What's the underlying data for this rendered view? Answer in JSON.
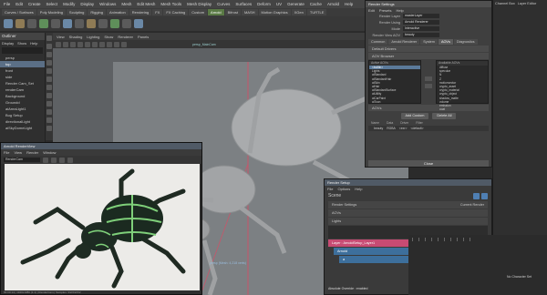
{
  "menubar": {
    "items": [
      "File",
      "Edit",
      "Create",
      "Select",
      "Modify",
      "Display",
      "Windows",
      "Mesh",
      "Edit Mesh",
      "Mesh Tools",
      "Mesh Display",
      "Curves",
      "Surfaces",
      "Deform",
      "UV",
      "Generate",
      "Cache",
      "Arnold",
      "Help"
    ]
  },
  "shelf": {
    "tabs": [
      "Curves / Surfaces",
      "Poly Modeling",
      "Sculpting",
      "Rigging",
      "Animation",
      "Rendering",
      "FX",
      "FX Caching",
      "Custom",
      "Arnold",
      "Bifrost",
      "MASH",
      "Motion Graphics",
      "XGen",
      "TURTLE"
    ],
    "active_index": 9
  },
  "outliner": {
    "title": "Outliner",
    "menu": [
      "Display",
      "Show",
      "Help"
    ],
    "items": [
      "persp",
      "top",
      "front",
      "side",
      "Render Cam_Set",
      "renderCam",
      "Background",
      "Groundd",
      "aiAreaLight1",
      "Bug Setup",
      "directionalLight",
      "aiSkyDomeLight"
    ],
    "selected_index": 1
  },
  "viewport": {
    "menu": [
      "View",
      "Shading",
      "Lighting",
      "Show",
      "Renderer",
      "Panels"
    ],
    "camera_label": "persp_MainCam",
    "status": "persp (Mesh: 4,218 verts)"
  },
  "render_view": {
    "title": "Arnold RenderView",
    "menu": [
      "File",
      "View",
      "Render",
      "Window"
    ],
    "camera": "RenderCam",
    "status": "00:00:14 | 1920x1080 (1:1) | RenderCam | Samples: 3/2/2/2/2/2"
  },
  "render_settings": {
    "title": "Render Settings",
    "menu": [
      "Edit",
      "Presets",
      "Help"
    ],
    "render_layer_label": "Render Layer",
    "render_layer_value": "masterLayer",
    "render_using_label": "Render Using",
    "render_using_value": "Arnold Renderer",
    "mode_label": "Mode",
    "mode_value": "Interactive",
    "render_view_aovs_label": "Render View AOV",
    "render_view_aovs_value": "beauty",
    "tabs": [
      "Common",
      "Arnold Renderer",
      "System",
      "AOVs",
      "Diagnostics"
    ],
    "active_tab_index": 3,
    "sections": [
      "Default Drivers",
      "AOV Browser"
    ],
    "aov_active_header": "Active AOVs",
    "aov_available_header": "Available AOVs",
    "aov_source_list": [
      "<builtin>",
      "Lights",
      "aiStandard",
      "aiStandardHair",
      "aiSkin",
      "aiHair",
      "aiStandardSurface",
      "aiUtility",
      "aiCarPaint",
      "aiToon"
    ],
    "aov_source_selected": 0,
    "aov_available_list": [
      "diffuse",
      "specular",
      "N",
      "Z",
      "motionvector",
      "crypto_asset",
      "crypto_material",
      "crypto_object",
      "shadow_matte",
      "volume",
      "emission",
      "coat"
    ],
    "aovs_section": "AOVs",
    "add_custom": "Add Custom",
    "delete_all": "Delete All",
    "table_headers": [
      "Name",
      "Data",
      "Driver",
      "Filter"
    ],
    "table_row": [
      "beauty",
      "RGBA",
      "<exr>",
      "<default>"
    ],
    "close": "Close"
  },
  "render_setup": {
    "title": "Render Setup",
    "menu": [
      "File",
      "Options",
      "Help"
    ],
    "scene_label": "Scene",
    "rows": [
      "Render Settings",
      "AOVs",
      "Lights"
    ],
    "current_render_label": "Current Render",
    "layer": "Layer : ArnoldSetup_Layer1",
    "collection": "Arnold",
    "subcollection": "a",
    "footer": "Absolute Override : enabled"
  },
  "right_panel": {
    "tabs": [
      "Channel Box",
      "Layer Editor"
    ]
  },
  "timeline": {
    "char_set": "No Character Set"
  },
  "colors": {
    "accent": "#5a7a45",
    "selection": "#5b6f86",
    "layer_pink": "#c74b73",
    "collection_blue": "#3d6f9c"
  }
}
